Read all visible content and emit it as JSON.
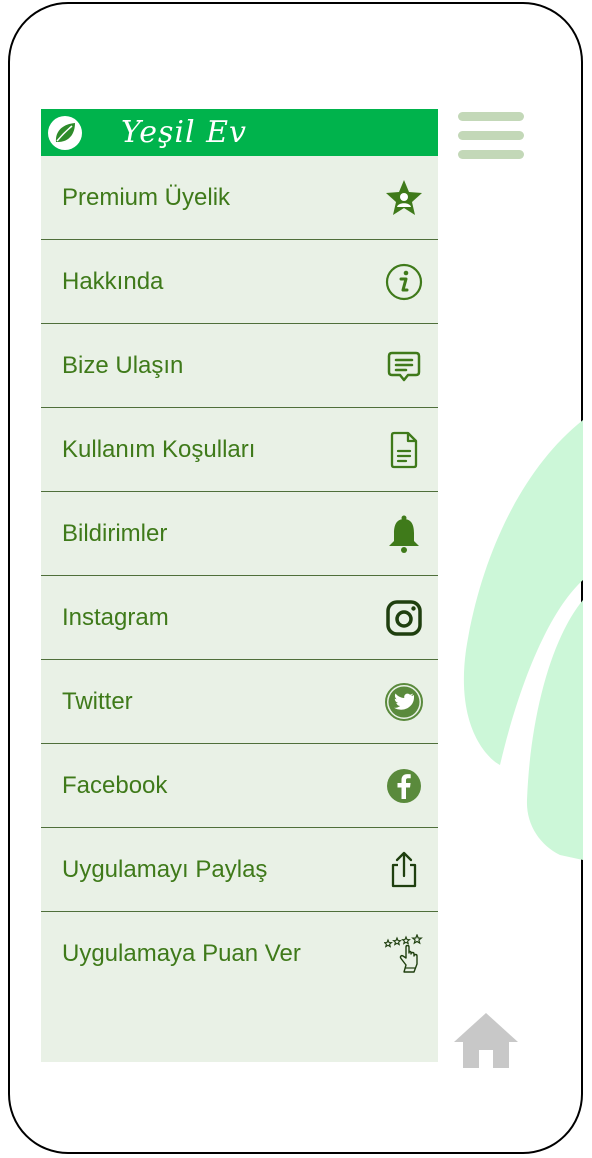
{
  "brand": {
    "title": "Yeşil Ev",
    "logo_icon": "leaf-icon",
    "header_color": "#00b34c"
  },
  "menu": {
    "items": [
      {
        "label": "Premium Üyelik",
        "icon": "premium-star-user-icon"
      },
      {
        "label": "Hakkında",
        "icon": "info-icon"
      },
      {
        "label": "Bize Ulaşın",
        "icon": "message-icon"
      },
      {
        "label": "Kullanım Koşulları",
        "icon": "document-icon"
      },
      {
        "label": "Bildirimler",
        "icon": "bell-icon"
      },
      {
        "label": "Instagram",
        "icon": "instagram-icon"
      },
      {
        "label": "Twitter",
        "icon": "twitter-icon"
      },
      {
        "label": "Facebook",
        "icon": "facebook-icon"
      },
      {
        "label": "Uygulamayı Paylaş",
        "icon": "share-icon"
      },
      {
        "label": "Uygulamaya Puan Ver",
        "icon": "rate-stars-icon"
      }
    ],
    "label_color": "#3f7a1a",
    "icon_color": "#3f7a1a",
    "background": "#e9f1e6"
  },
  "nav": {
    "hamburger_icon": "hamburger-menu-icon",
    "home_icon": "home-icon"
  }
}
